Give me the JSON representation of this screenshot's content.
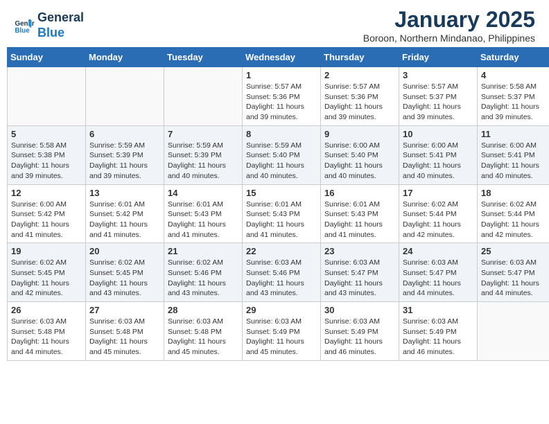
{
  "header": {
    "logo_line1": "General",
    "logo_line2": "Blue",
    "month": "January 2025",
    "location": "Boroon, Northern Mindanao, Philippines"
  },
  "weekdays": [
    "Sunday",
    "Monday",
    "Tuesday",
    "Wednesday",
    "Thursday",
    "Friday",
    "Saturday"
  ],
  "weeks": [
    [
      {
        "day": "",
        "info": ""
      },
      {
        "day": "",
        "info": ""
      },
      {
        "day": "",
        "info": ""
      },
      {
        "day": "1",
        "info": "Sunrise: 5:57 AM\nSunset: 5:36 PM\nDaylight: 11 hours\nand 39 minutes."
      },
      {
        "day": "2",
        "info": "Sunrise: 5:57 AM\nSunset: 5:36 PM\nDaylight: 11 hours\nand 39 minutes."
      },
      {
        "day": "3",
        "info": "Sunrise: 5:57 AM\nSunset: 5:37 PM\nDaylight: 11 hours\nand 39 minutes."
      },
      {
        "day": "4",
        "info": "Sunrise: 5:58 AM\nSunset: 5:37 PM\nDaylight: 11 hours\nand 39 minutes."
      }
    ],
    [
      {
        "day": "5",
        "info": "Sunrise: 5:58 AM\nSunset: 5:38 PM\nDaylight: 11 hours\nand 39 minutes."
      },
      {
        "day": "6",
        "info": "Sunrise: 5:59 AM\nSunset: 5:39 PM\nDaylight: 11 hours\nand 39 minutes."
      },
      {
        "day": "7",
        "info": "Sunrise: 5:59 AM\nSunset: 5:39 PM\nDaylight: 11 hours\nand 40 minutes."
      },
      {
        "day": "8",
        "info": "Sunrise: 5:59 AM\nSunset: 5:40 PM\nDaylight: 11 hours\nand 40 minutes."
      },
      {
        "day": "9",
        "info": "Sunrise: 6:00 AM\nSunset: 5:40 PM\nDaylight: 11 hours\nand 40 minutes."
      },
      {
        "day": "10",
        "info": "Sunrise: 6:00 AM\nSunset: 5:41 PM\nDaylight: 11 hours\nand 40 minutes."
      },
      {
        "day": "11",
        "info": "Sunrise: 6:00 AM\nSunset: 5:41 PM\nDaylight: 11 hours\nand 40 minutes."
      }
    ],
    [
      {
        "day": "12",
        "info": "Sunrise: 6:00 AM\nSunset: 5:42 PM\nDaylight: 11 hours\nand 41 minutes."
      },
      {
        "day": "13",
        "info": "Sunrise: 6:01 AM\nSunset: 5:42 PM\nDaylight: 11 hours\nand 41 minutes."
      },
      {
        "day": "14",
        "info": "Sunrise: 6:01 AM\nSunset: 5:43 PM\nDaylight: 11 hours\nand 41 minutes."
      },
      {
        "day": "15",
        "info": "Sunrise: 6:01 AM\nSunset: 5:43 PM\nDaylight: 11 hours\nand 41 minutes."
      },
      {
        "day": "16",
        "info": "Sunrise: 6:01 AM\nSunset: 5:43 PM\nDaylight: 11 hours\nand 41 minutes."
      },
      {
        "day": "17",
        "info": "Sunrise: 6:02 AM\nSunset: 5:44 PM\nDaylight: 11 hours\nand 42 minutes."
      },
      {
        "day": "18",
        "info": "Sunrise: 6:02 AM\nSunset: 5:44 PM\nDaylight: 11 hours\nand 42 minutes."
      }
    ],
    [
      {
        "day": "19",
        "info": "Sunrise: 6:02 AM\nSunset: 5:45 PM\nDaylight: 11 hours\nand 42 minutes."
      },
      {
        "day": "20",
        "info": "Sunrise: 6:02 AM\nSunset: 5:45 PM\nDaylight: 11 hours\nand 43 minutes."
      },
      {
        "day": "21",
        "info": "Sunrise: 6:02 AM\nSunset: 5:46 PM\nDaylight: 11 hours\nand 43 minutes."
      },
      {
        "day": "22",
        "info": "Sunrise: 6:03 AM\nSunset: 5:46 PM\nDaylight: 11 hours\nand 43 minutes."
      },
      {
        "day": "23",
        "info": "Sunrise: 6:03 AM\nSunset: 5:47 PM\nDaylight: 11 hours\nand 43 minutes."
      },
      {
        "day": "24",
        "info": "Sunrise: 6:03 AM\nSunset: 5:47 PM\nDaylight: 11 hours\nand 44 minutes."
      },
      {
        "day": "25",
        "info": "Sunrise: 6:03 AM\nSunset: 5:47 PM\nDaylight: 11 hours\nand 44 minutes."
      }
    ],
    [
      {
        "day": "26",
        "info": "Sunrise: 6:03 AM\nSunset: 5:48 PM\nDaylight: 11 hours\nand 44 minutes."
      },
      {
        "day": "27",
        "info": "Sunrise: 6:03 AM\nSunset: 5:48 PM\nDaylight: 11 hours\nand 45 minutes."
      },
      {
        "day": "28",
        "info": "Sunrise: 6:03 AM\nSunset: 5:48 PM\nDaylight: 11 hours\nand 45 minutes."
      },
      {
        "day": "29",
        "info": "Sunrise: 6:03 AM\nSunset: 5:49 PM\nDaylight: 11 hours\nand 45 minutes."
      },
      {
        "day": "30",
        "info": "Sunrise: 6:03 AM\nSunset: 5:49 PM\nDaylight: 11 hours\nand 46 minutes."
      },
      {
        "day": "31",
        "info": "Sunrise: 6:03 AM\nSunset: 5:49 PM\nDaylight: 11 hours\nand 46 minutes."
      },
      {
        "day": "",
        "info": ""
      }
    ]
  ]
}
